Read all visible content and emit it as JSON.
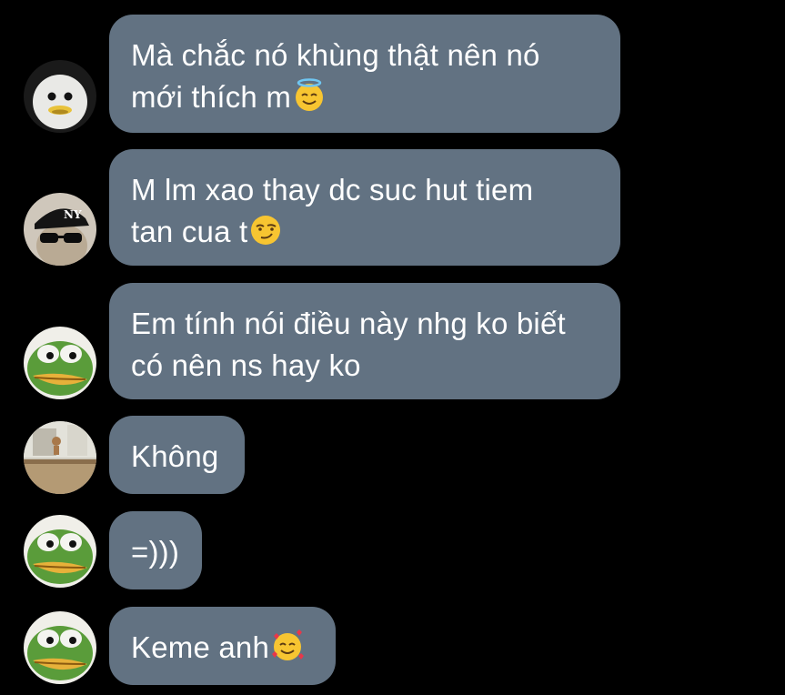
{
  "messages": [
    {
      "lines": [
        "Mà chắc nó khùng thật nên nó",
        "mới thích m"
      ],
      "emoji": "smiling-face-with-halo",
      "avatar": "white-bird-avatar"
    },
    {
      "lines": [
        "M lm xao thay dc suc hut tiem",
        "tan cua t"
      ],
      "emoji": "smirking-face",
      "avatar": "cat-cap-sunglasses-avatar"
    },
    {
      "lines": [
        "Em tính nói điều này nhg ko biết",
        "có nên ns hay ko"
      ],
      "emoji": "",
      "avatar": "pepe-frog-avatar"
    },
    {
      "lines": [
        "Không"
      ],
      "emoji": "",
      "avatar": "room-photo-avatar"
    },
    {
      "lines": [
        "=)))"
      ],
      "emoji": "",
      "avatar": "pepe-frog-avatar"
    },
    {
      "lines": [
        "Keme anh"
      ],
      "emoji": "smiling-face-with-hearts",
      "avatar": "pepe-frog-avatar"
    }
  ],
  "colors": {
    "background": "#000000",
    "bubble": "#627282",
    "text": "#ffffff"
  }
}
